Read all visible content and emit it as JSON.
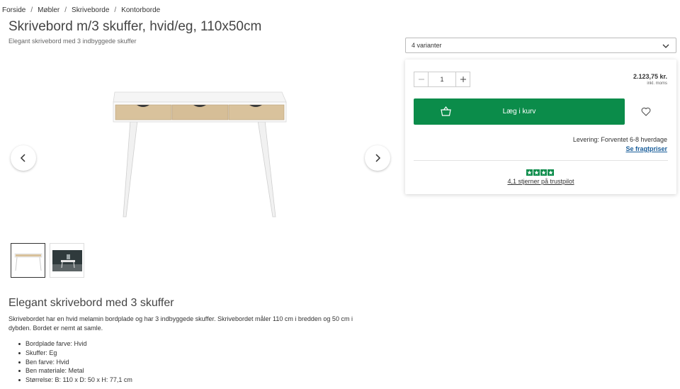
{
  "breadcrumb": [
    "Forside",
    "Møbler",
    "Skriveborde",
    "Kontorborde"
  ],
  "breadcrumb_sep": "/",
  "product": {
    "title": "Skrivebord m/3 skuffer, hvid/eg, 110x50cm",
    "subtitle": "Elegant skrivebord med 3 indbyggede skuffer"
  },
  "variant": {
    "selected": "4 varianter"
  },
  "buy": {
    "quantity": "1",
    "price": "2.123,75 kr.",
    "price_note": "inkl. moms",
    "add_to_cart": "Læg i kurv",
    "delivery": "Levering: Forventet 6-8 hverdage",
    "freight_link": "Se fragtpriser",
    "trustpilot": "4,1 stjerner på trustpilot"
  },
  "description": {
    "title": "Elegant skrivebord med 3 skuffer",
    "text": "Skrivebordet har en hvid melamin bordplade og har 3 indbyggede skuffer. Skrivebordet måler 110 cm i bredden og 50 cm i dybden. Bordet er nemt at samle.",
    "specs": [
      "Bordplade farve: Hvid",
      "Skuffer: Eg",
      "Ben farve: Hvid",
      "Ben materiale: Metal",
      "Størrelse: B: 110  x D: 50 x H: 77,1 cm"
    ]
  },
  "colors": {
    "accent": "#0b8c4a",
    "link": "#1a5e9a"
  },
  "icons": [
    "chevron-down-icon",
    "minus-icon",
    "plus-icon",
    "basket-icon",
    "heart-icon",
    "star-icon",
    "arrow-left-icon",
    "arrow-right-icon"
  ]
}
